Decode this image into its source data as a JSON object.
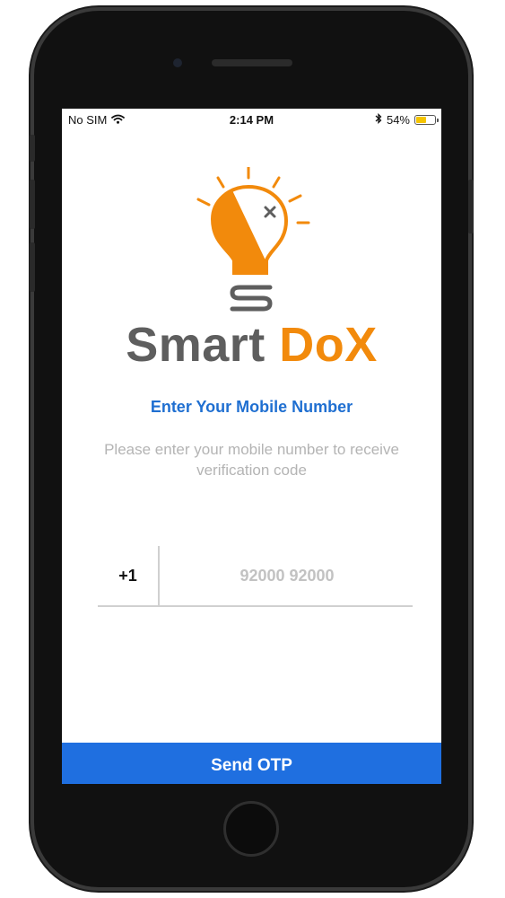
{
  "status_bar": {
    "carrier": "No SIM",
    "time": "2:14 PM",
    "battery": "54%",
    "battery_level": 0.54,
    "icons": [
      "wifi-icon",
      "bluetooth-icon",
      "battery-icon"
    ]
  },
  "brand": {
    "name_part1": "Smart",
    "name_part2": "DoX",
    "colors": {
      "gray": "#5e5e5e",
      "orange": "#f28a0c"
    }
  },
  "form": {
    "heading": "Enter Your Mobile Number",
    "subtext": "Please enter your mobile number to receive verification code",
    "country_code": "+1",
    "phone_value": "",
    "phone_placeholder": "92000 92000",
    "submit_label": "Send OTP"
  },
  "colors": {
    "accent_blue": "#1f6fe0",
    "heading_blue": "#1f6fd1"
  }
}
